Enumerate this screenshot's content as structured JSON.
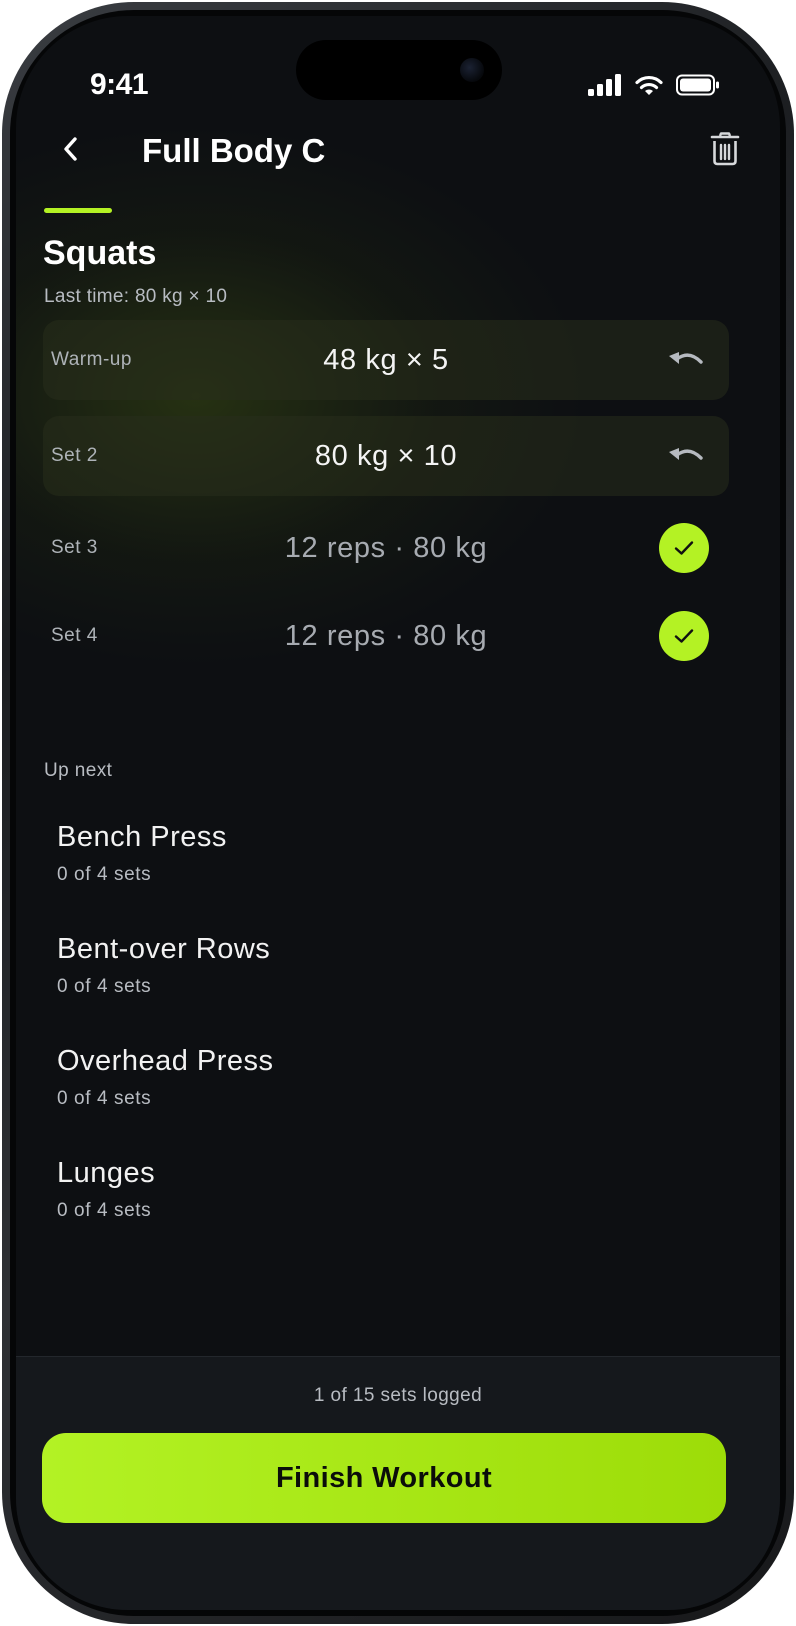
{
  "status_bar": {
    "time": "9:41",
    "icons": [
      "cellular-signal-icon",
      "wifi-icon",
      "battery-icon"
    ]
  },
  "header": {
    "back_icon": "chevron-left-icon",
    "title": "Full Body C",
    "delete_icon": "trash-icon"
  },
  "exercise": {
    "name": "Squats",
    "last_time": "Last time: 80 kg × 10",
    "sets": [
      {
        "label": "Warm-up",
        "value": "48 kg × 5",
        "status": "logged",
        "action_icon": "undo-icon"
      },
      {
        "label": "Set 2",
        "value": "80 kg × 10",
        "status": "logged",
        "action_icon": "undo-icon"
      },
      {
        "label": "Set 3",
        "value": "12 reps · 80 kg",
        "status": "pending",
        "action_icon": "checkmark-icon"
      },
      {
        "label": "Set 4",
        "value": "12 reps · 80 kg",
        "status": "pending",
        "action_icon": "checkmark-icon"
      }
    ]
  },
  "up_next": {
    "label": "Up next",
    "items": [
      {
        "name": "Bench Press",
        "sets": "0 of 4 sets"
      },
      {
        "name": "Bent-over Rows",
        "sets": "0 of 4 sets"
      },
      {
        "name": "Overhead Press",
        "sets": "0 of 4 sets"
      },
      {
        "name": "Lunges",
        "sets": "0 of 4 sets"
      }
    ]
  },
  "footer": {
    "progress": "1 of 15 sets logged",
    "finish_label": "Finish Workout"
  },
  "colors": {
    "accent": "#b4f224",
    "background": "#0d0f12",
    "panel": "#15181c"
  }
}
